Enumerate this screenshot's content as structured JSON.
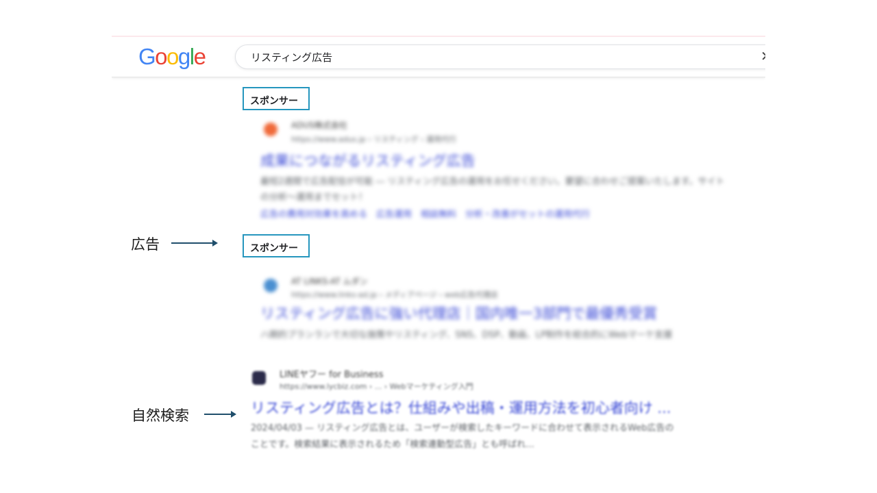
{
  "search": {
    "query": "リスティング広告"
  },
  "annotations": {
    "ad_label": "広告",
    "organic_label": "自然検索"
  },
  "results": [
    {
      "sponsor_label": "スポンサー",
      "site": "ADUS株式会社",
      "url": "https://www.adus.jp › リスティング › 運用代行",
      "title": "成果につながるリスティング広告",
      "desc1": "最短2週間で広告配信が可能 ― リスティング広告の運用をお任せください。要望に合わせご提案いたします。サイト",
      "desc2": "の分析～運用までセット！",
      "links": "広告の費用対効果を高める　広告運用　相談無料　分析・改善がセットの運用代行",
      "favicon_color": "#f06a3a"
    },
    {
      "sponsor_label": "スポンサー",
      "site": "AT LINKS-AT ムダン",
      "url": "https://www.links-ad.jp › メディアページ › web広告代理店",
      "title": "リスティング広告に強い代理店｜国内唯一3部門で最優秀受賞",
      "desc1": "ハ期的プランランで大切な施策やリスティング、SNS、DSP、動画、LP制作を総合的にWebマーケ支援",
      "favicon_color": "#4a8fd1"
    },
    {
      "site": "LINEヤフー for Business",
      "url": "https://www.lycbiz.com › ... › Webマーケティング入門",
      "title": "リスティング広告とは？仕組みや出稿・運用方法を初心者向け ...",
      "desc1": "2024/04/03 — リスティング広告とは、ユーザーが検索したキーワードに合わせて表示されるWeb広告の",
      "desc2": "ことです。検索結果に表示されるため「検索連動型広告」とも呼ばれ...",
      "favicon_color": "#2b2b4a"
    }
  ],
  "colors": {
    "sponsor_border": "#2596be",
    "link_blue": "#3b4ad6",
    "arrow": "#1f4e6b"
  }
}
